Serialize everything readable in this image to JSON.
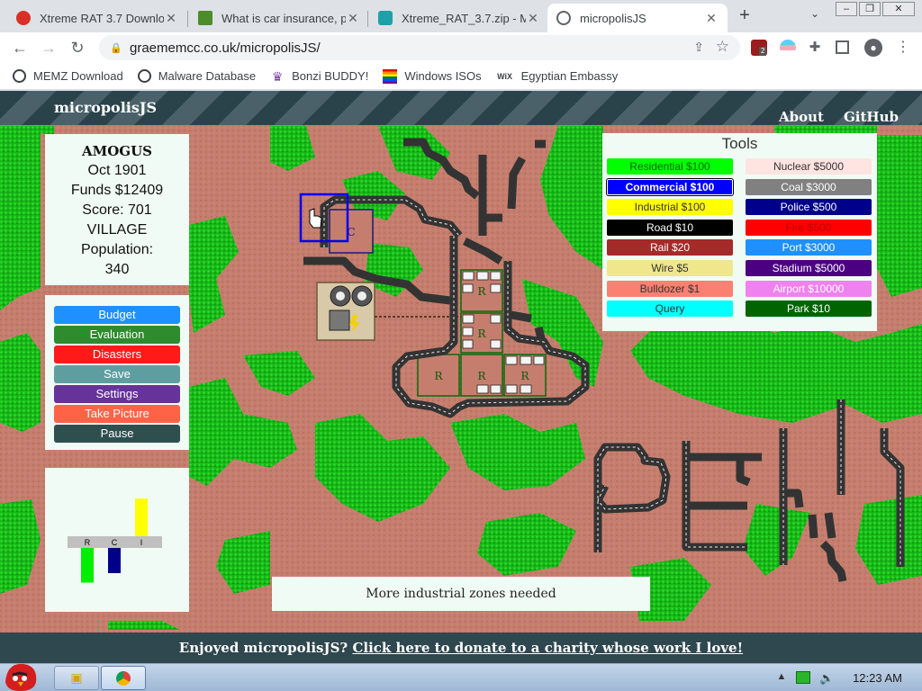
{
  "browser": {
    "tabs": [
      {
        "title": "Xtreme RAT 3.7 Downlo",
        "favicon_color": "#d93025",
        "active": false
      },
      {
        "title": "What is car insurance, p",
        "favicon_color": "#4c8c2b",
        "active": false
      },
      {
        "title": "Xtreme_RAT_3.7.zip - M",
        "favicon_color": "#1da1a8",
        "active": false
      },
      {
        "title": "micropolisJS",
        "favicon_color": "#5f6368",
        "active": true
      }
    ],
    "url": "graememcc.co.uk/micropolisJS/",
    "extension_badge": "2",
    "bookmarks": [
      {
        "label": "MEMZ Download",
        "icon": "globe-icon"
      },
      {
        "label": "Malware Database",
        "icon": "globe-icon"
      },
      {
        "label": "Bonzi BUDDY!",
        "icon": "bonzi-icon"
      },
      {
        "label": "Windows ISOs",
        "icon": "rainbow-flag-icon"
      },
      {
        "label": "Egyptian Embassy",
        "icon": "wix-icon"
      }
    ]
  },
  "game": {
    "logo": "micropolisJS",
    "nav": {
      "about": "About",
      "github": "GitHub"
    },
    "info": {
      "city": "AMOGUS",
      "date": "Oct 1901",
      "funds": "Funds $12409",
      "score": "Score: 701",
      "class": "VILLAGE",
      "population_label": "Population:",
      "population": "340"
    },
    "menu": [
      {
        "label": "Budget",
        "color": "#1e90ff"
      },
      {
        "label": "Evaluation",
        "color": "#2e8b2e"
      },
      {
        "label": "Disasters",
        "color": "#ff1a1a"
      },
      {
        "label": "Save",
        "color": "#5f9ea0"
      },
      {
        "label": "Settings",
        "color": "#663399"
      },
      {
        "label": "Take Picture",
        "color": "#ff6347"
      },
      {
        "label": "Pause",
        "color": "#2f4f4f"
      }
    ],
    "rci": {
      "labels": [
        "R",
        "C",
        "I"
      ],
      "demand": [
        -0.55,
        -0.4,
        0.6
      ],
      "colors": [
        "#00ee00",
        "#00008b",
        "#ffff00"
      ]
    },
    "tools": {
      "title": "Tools",
      "selected": "Commercial $100",
      "left": [
        {
          "label": "Residential $100",
          "bg": "#00ff00",
          "fg": "#006400"
        },
        {
          "label": "Commercial $100",
          "bg": "#0000ff",
          "fg": "#ffffff"
        },
        {
          "label": "Industrial $100",
          "bg": "#ffff00",
          "fg": "#333333"
        },
        {
          "label": "Road $10",
          "bg": "#000000",
          "fg": "#ffffff"
        },
        {
          "label": "Rail $20",
          "bg": "#a52a2a",
          "fg": "#ffffff"
        },
        {
          "label": "Wire $5",
          "bg": "#f0e68c",
          "fg": "#333333"
        },
        {
          "label": "Bulldozer $1",
          "bg": "#fa8072",
          "fg": "#333333"
        },
        {
          "label": "Query",
          "bg": "#00ffff",
          "fg": "#333333"
        }
      ],
      "right": [
        {
          "label": "Nuclear $5000",
          "bg": "#ffe4e1",
          "fg": "#333333"
        },
        {
          "label": "Coal $3000",
          "bg": "#808080",
          "fg": "#ffffff"
        },
        {
          "label": "Police $500",
          "bg": "#00008b",
          "fg": "#ffffff"
        },
        {
          "label": "Fire $500",
          "bg": "#ff0000",
          "fg": "#c00000"
        },
        {
          "label": "Port $3000",
          "bg": "#1e90ff",
          "fg": "#ffffff"
        },
        {
          "label": "Stadium $5000",
          "bg": "#4b0082",
          "fg": "#ffffff"
        },
        {
          "label": "Airport $10000",
          "bg": "#ee82ee",
          "fg": "#ffffff"
        },
        {
          "label": "Park $10",
          "bg": "#006400",
          "fg": "#ffffff"
        }
      ]
    },
    "message": "More industrial zones needed",
    "footer": {
      "prefix": "Enjoyed micropolisJS?",
      "link": "Click here to donate to a charity whose work I love!"
    }
  },
  "taskbar": {
    "clock": "12:23 AM"
  }
}
